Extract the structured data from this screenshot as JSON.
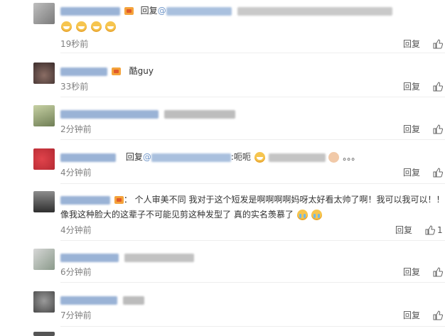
{
  "comments": [
    {
      "reply_prefix": "回复",
      "mention_prefix": "@",
      "time": "19秒前",
      "reply_label": "回复"
    },
    {
      "content": "酷guy",
      "time": "33秒前",
      "reply_label": "回复"
    },
    {
      "time": "2分钟前",
      "reply_label": "回复"
    },
    {
      "reply_prefix": "回复",
      "mention_prefix": "@",
      "content": ":呃呃",
      "ellipsis": "。。。",
      "time": "4分钟前",
      "reply_label": "回复"
    },
    {
      "content_line1": "：  个人审美不同 我对于这个短发是啊啊啊啊妈呀太好看太帅了啊！我可以我可以！！",
      "content_line2": "像我这种脸大的这辈子不可能见剪这种发型了 真的实名羡慕了",
      "time": "4分钟前",
      "reply_label": "回复",
      "like_count": "1"
    },
    {
      "time": "6分钟前",
      "reply_label": "回复"
    },
    {
      "time": "7分钟前",
      "reply_label": "回复"
    }
  ],
  "icons": {
    "like": "thumbs-up-icon",
    "emoji": "emoji-icon"
  },
  "colors": {
    "username": "#6e95c8",
    "time": "#808080",
    "separator": "#eeeeee"
  }
}
